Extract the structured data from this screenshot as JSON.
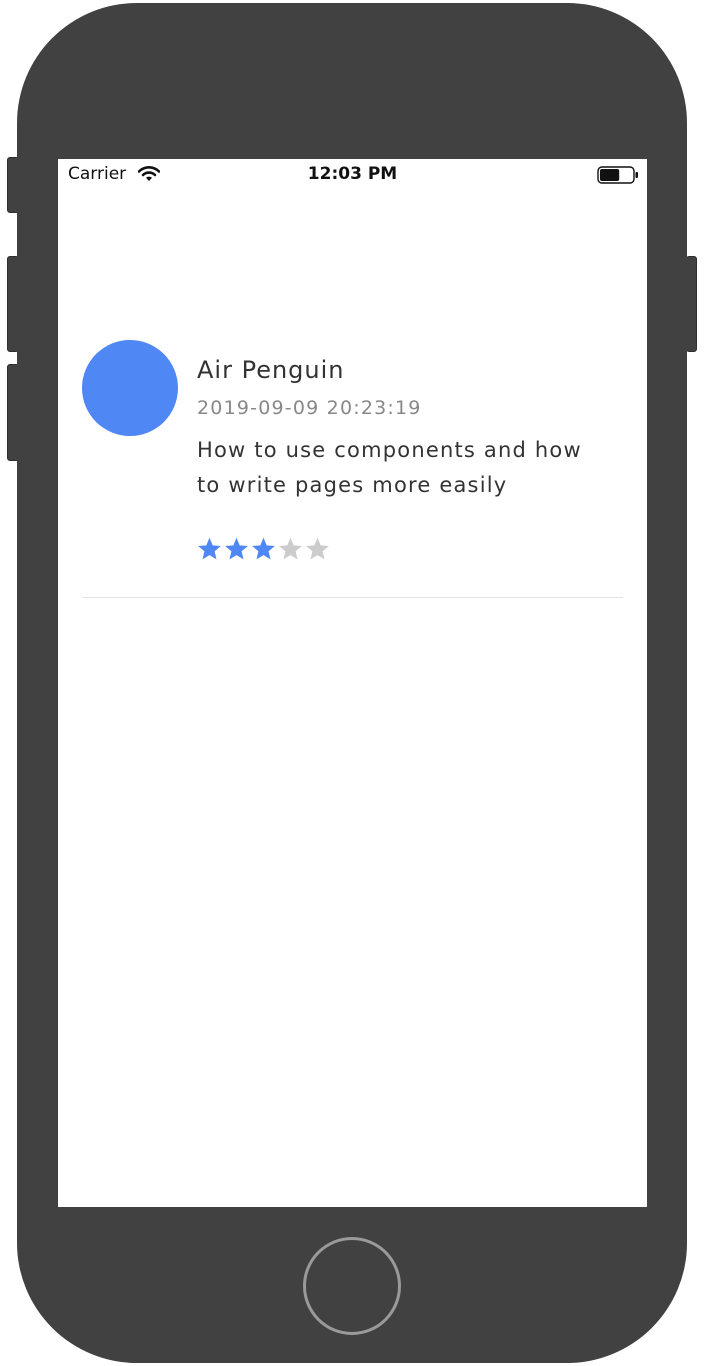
{
  "status_bar": {
    "carrier": "Carrier",
    "time": "12:03 PM",
    "battery_level": 0.6,
    "icons": [
      "wifi-icon",
      "battery-icon"
    ]
  },
  "comment": {
    "author": "Air Penguin",
    "timestamp": "2019-09-09 20:23:19",
    "content": "How to use components and how to write pages more easily",
    "rating": 3,
    "rating_max": 5,
    "avatar_color": "#4f87f5"
  },
  "colors": {
    "accent": "#4f87f5",
    "star_active": "#4f87f5",
    "star_inactive": "#cccccc",
    "device_frame": "#414141"
  }
}
